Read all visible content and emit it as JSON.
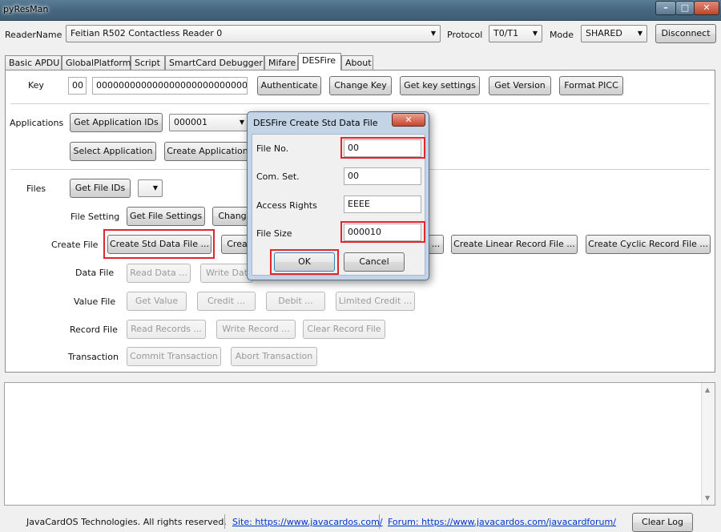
{
  "window": {
    "title": "pyResMan",
    "min": "–",
    "max": "□",
    "close": "✕"
  },
  "top": {
    "reader_label": "ReaderName",
    "reader_value": "Feitian R502 Contactless Reader 0",
    "protocol_label": "Protocol",
    "protocol_value": "T0/T1",
    "mode_label": "Mode",
    "mode_value": "SHARED",
    "disconnect": "Disconnect"
  },
  "tabs": [
    "Basic APDU",
    "GlobalPlatform",
    "Script",
    "SmartCard Debugger",
    "Mifare",
    "DESFire",
    "About"
  ],
  "active_tab": "DESFire",
  "key": {
    "label": "Key",
    "key_no": "00",
    "key_value": "00000000000000000000000000000000",
    "buttons": [
      "Authenticate",
      "Change Key",
      "Get key settings",
      "Get Version",
      "Format PICC"
    ]
  },
  "applications": {
    "label": "Applications",
    "get_ids": "Get Application IDs",
    "aid_value": "000001",
    "select": "Select Application",
    "create": "Create Application"
  },
  "files": {
    "label": "Files",
    "get_ids": "Get File IDs",
    "file_setting_label": "File Setting",
    "get_settings": "Get File Settings",
    "change": "Chang",
    "create_file_label": "Create File",
    "create_std": "Create Std Data File ...",
    "create_backup": "Crea",
    "create_value_tail": "...",
    "create_linear": "Create Linear Record File ...",
    "create_cyclic": "Create Cyclic Record File ...",
    "data_file_label": "Data File",
    "read_data": "Read Data ...",
    "write_data": "Write Dat",
    "value_file_label": "Value File",
    "get_value": "Get Value",
    "credit": "Credit ...",
    "debit": "Debit ...",
    "limited_credit": "Limited Credit ...",
    "record_file_label": "Record File",
    "read_records": "Read Records ...",
    "write_record": "Write Record ...",
    "clear_record": "Clear Record File",
    "transaction_label": "Transaction",
    "commit": "Commit Transaction",
    "abort": "Abort Transaction"
  },
  "dialog": {
    "title": "DESFire Create Std Data File",
    "close": "✕",
    "file_no_label": "File No.",
    "file_no": "00",
    "comm_label": "Com. Set.",
    "comm": "00",
    "access_label": "Access Rights",
    "access": "EEEE",
    "size_label": "File Size",
    "size": "000010",
    "ok": "OK",
    "cancel": "Cancel"
  },
  "scrollbar": {
    "up": "▲",
    "down": "▼"
  },
  "footer": {
    "copyright": "JavaCardOS Technologies. All rights reserved.",
    "site": "Site: https://www.javacardos.com/",
    "forum": "Forum: https://www.javacardos.com/javacardforum/",
    "clear_log": "Clear Log"
  },
  "colors": {
    "highlight": "#e3262b",
    "title_bar": "#46677f",
    "dialog_frame": "#c3d4e6",
    "link": "#0033cc"
  }
}
